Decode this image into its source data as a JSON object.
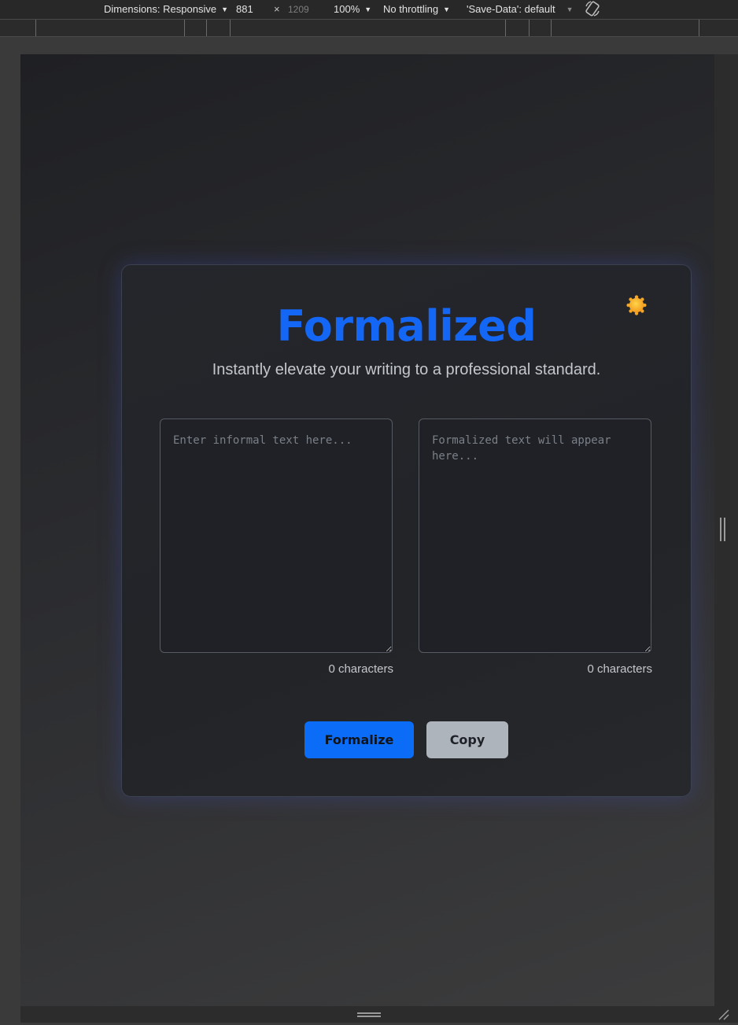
{
  "devtools": {
    "dimensions_label": "Dimensions: Responsive",
    "width_value": "881",
    "times_sign": "×",
    "height_value": "1209",
    "zoom": "100%",
    "throttling": "No throttling",
    "save_data": "'Save-Data': default"
  },
  "app": {
    "title": "Formalized",
    "subtitle": "Instantly elevate your writing to a professional standard.",
    "input": {
      "value": "",
      "placeholder": "Enter informal text here...",
      "count_label": "0 characters"
    },
    "output": {
      "value": "",
      "placeholder": "Formalized text will appear here...",
      "count_label": "0 characters"
    },
    "buttons": {
      "formalize": "Formalize",
      "copy": "Copy"
    },
    "theme_toggle_icon": "sun-icon",
    "colors": {
      "accent": "#1466f5",
      "primary_button": "#0b6cf7",
      "secondary_button": "#aeb4bb",
      "sun": "#f6a623"
    }
  }
}
